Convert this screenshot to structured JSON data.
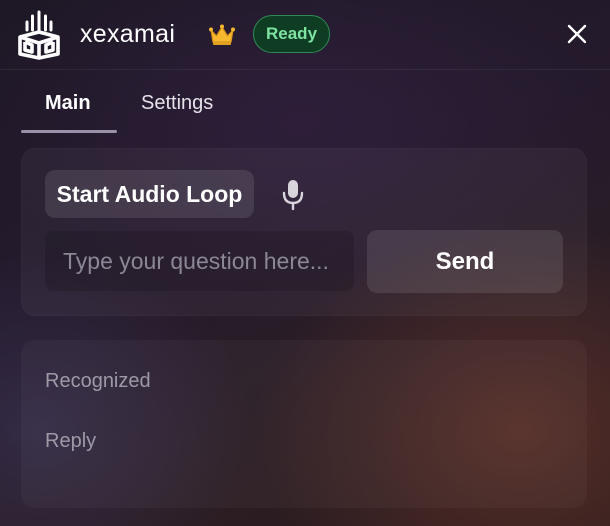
{
  "header": {
    "app_name": "xexamai",
    "status_badge": "Ready",
    "logo_icon": "brand-logo-icon",
    "crown_icon": "crown-icon",
    "close_icon": "close-icon"
  },
  "tabs": [
    {
      "label": "Main",
      "active": true
    },
    {
      "label": "Settings",
      "active": false
    }
  ],
  "controls": {
    "audio_loop_label": "Start Audio Loop",
    "mic_icon": "microphone-icon",
    "question_placeholder": "Type your question here...",
    "question_value": "",
    "send_label": "Send"
  },
  "results": {
    "recognized_label": "Recognized",
    "reply_label": "Reply"
  },
  "colors": {
    "badge_background": "#0f3d24",
    "badge_border": "#2f8a55",
    "badge_text": "#7ee2a0",
    "crown": "#f5b82e"
  }
}
